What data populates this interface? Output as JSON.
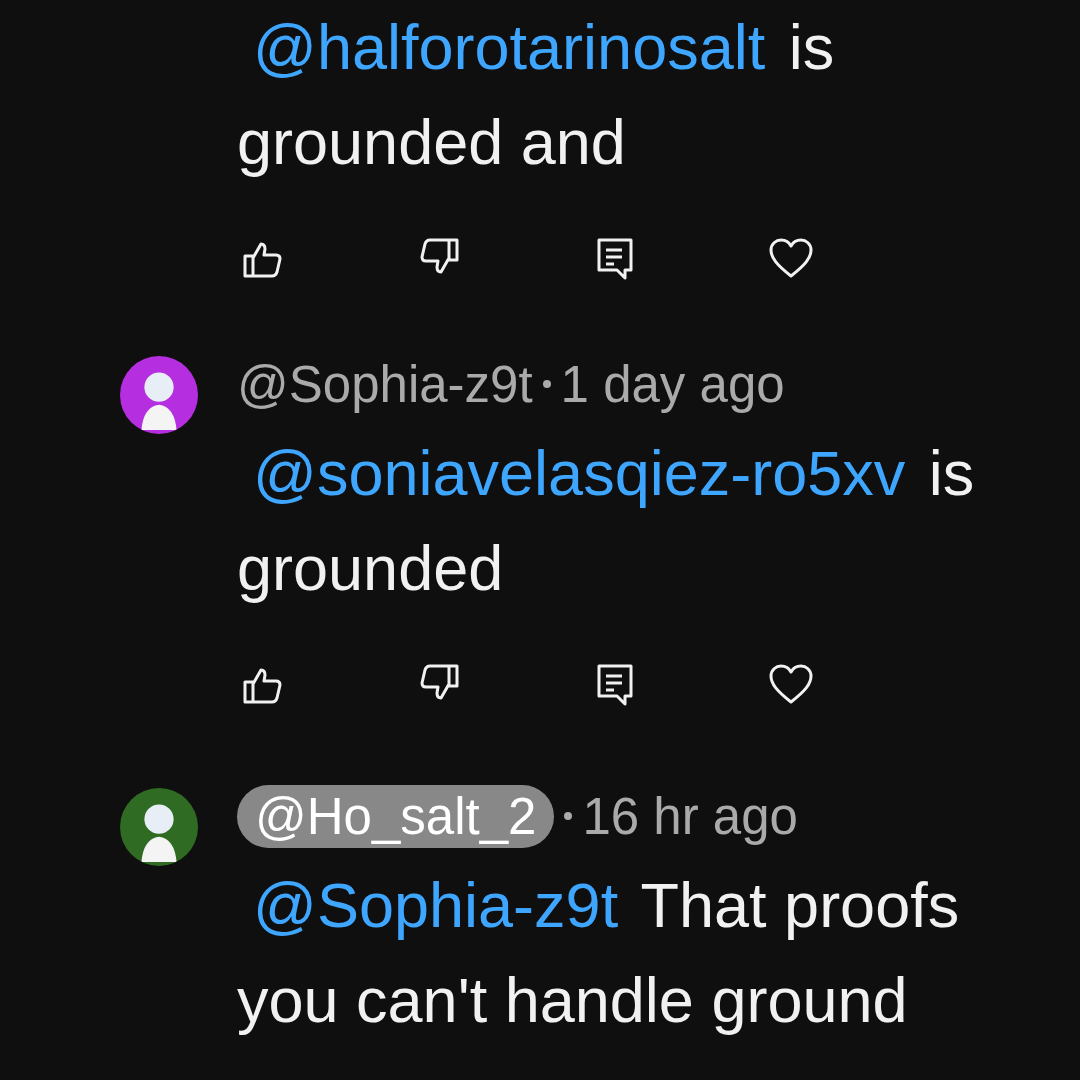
{
  "comments": [
    {
      "mention": "@halforotarinosalt",
      "text": "is grounded and"
    },
    {
      "color": "#b52ee0",
      "author": "@Sophia-z9t",
      "author_highlighted": false,
      "time": "1 day ago",
      "mention": "@soniavelasqiez-ro5xv",
      "text": "is grounded"
    },
    {
      "color": "#2f6b22",
      "author": "@Ho_salt_2",
      "author_highlighted": true,
      "time": "16 hr ago",
      "mention": "@Sophia-z9t",
      "text": "That proofs you can't handle ground"
    }
  ]
}
